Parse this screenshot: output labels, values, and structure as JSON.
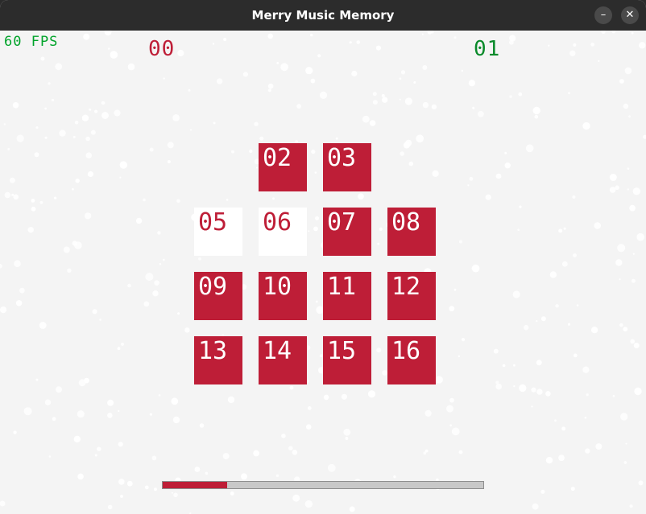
{
  "window": {
    "title": "Merry Music Memory",
    "minimize_label": "–",
    "close_label": "✕"
  },
  "hud": {
    "fps": "60 FPS",
    "score_player1": "00",
    "score_player2": "01"
  },
  "colors": {
    "tile_red": "#be1e37",
    "tile_white": "#ffffff",
    "fps_green": "#00a32a",
    "score2_green": "#0a8a2a",
    "background": "#f4f4f4"
  },
  "tiles": [
    {
      "label": "02",
      "state": "facedown"
    },
    {
      "label": "03",
      "state": "facedown"
    },
    {
      "label": "05",
      "state": "faceup"
    },
    {
      "label": "06",
      "state": "faceup"
    },
    {
      "label": "07",
      "state": "facedown"
    },
    {
      "label": "08",
      "state": "facedown"
    },
    {
      "label": "09",
      "state": "facedown"
    },
    {
      "label": "10",
      "state": "facedown"
    },
    {
      "label": "11",
      "state": "facedown"
    },
    {
      "label": "12",
      "state": "facedown"
    },
    {
      "label": "13",
      "state": "facedown"
    },
    {
      "label": "14",
      "state": "facedown"
    },
    {
      "label": "15",
      "state": "facedown"
    },
    {
      "label": "16",
      "state": "facedown"
    }
  ],
  "progress": {
    "fraction": 0.2
  }
}
